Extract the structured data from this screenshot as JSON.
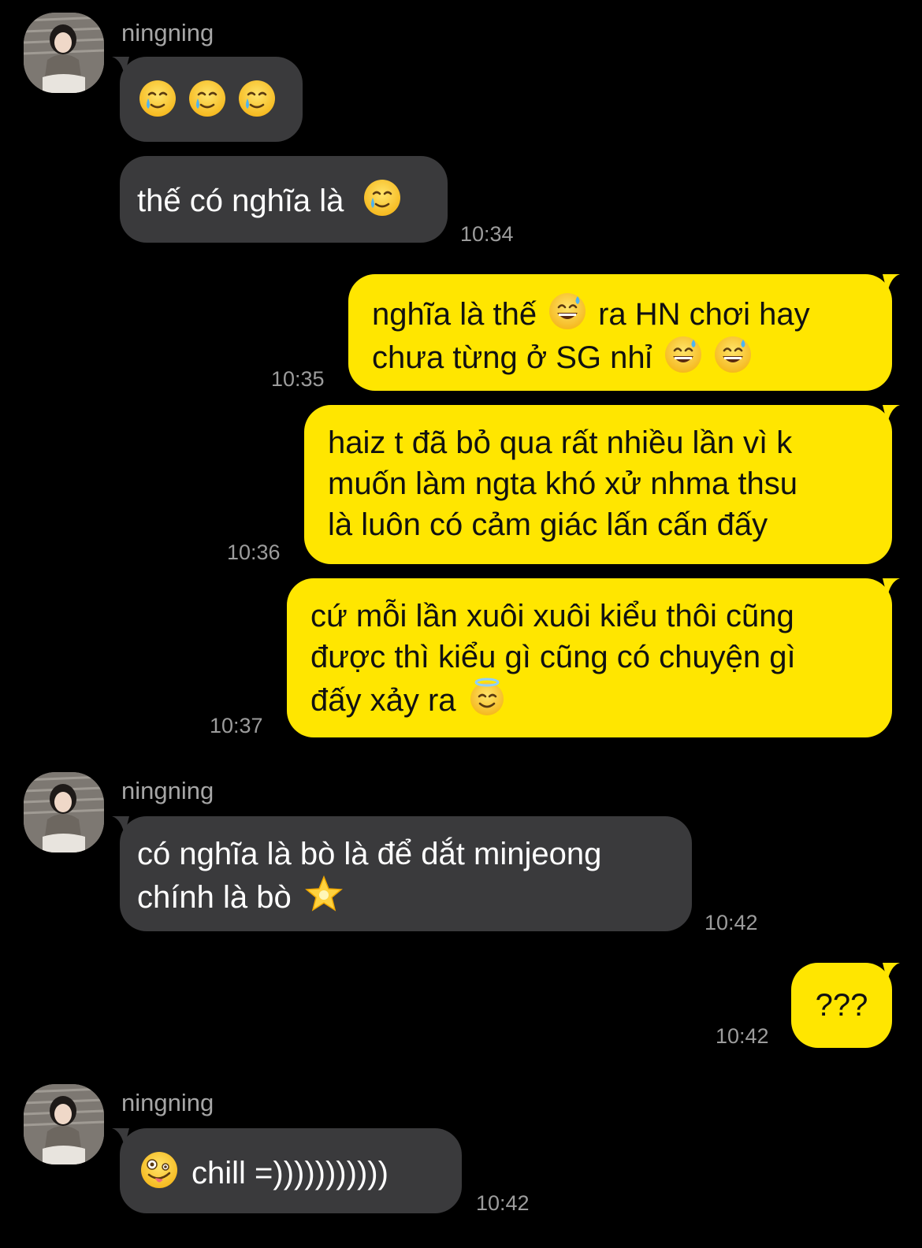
{
  "contact": {
    "name": "ningning"
  },
  "messages": [
    {
      "sender": "ningning",
      "emoji_only": [
        "crying-smile-emoji",
        "crying-smile-emoji",
        "crying-smile-emoji"
      ]
    },
    {
      "sender": "ningning",
      "text": "thế có nghĩa là",
      "emoji": "crying-smile-emoji",
      "time": "10:34"
    },
    {
      "sender": "me",
      "lines": [
        "nghĩa là thế",
        "ra HN chơi hay",
        "chưa từng ở SG nhỉ"
      ],
      "time": "10:35"
    },
    {
      "sender": "me",
      "lines": [
        "haiz t đã bỏ qua rất nhiều lần vì k",
        "muốn làm ngta khó xử nhma thsu",
        "là luôn có cảm giác lấn cấn đấy"
      ],
      "time": "10:36"
    },
    {
      "sender": "me",
      "lines": [
        "cứ mỗi lần xuôi xuôi kiểu thôi cũng",
        "được thì kiểu gì cũng có chuyện gì",
        "đấy xảy ra"
      ],
      "time": "10:37"
    },
    {
      "sender": "ningning",
      "lines": [
        "có nghĩa là bò là để dắt minjeong",
        "chính là bò"
      ],
      "time": "10:42"
    },
    {
      "sender": "me",
      "text": "???",
      "time": "10:42"
    },
    {
      "sender": "ningning",
      "text": "chill =)))))))))))",
      "time": "10:42"
    }
  ],
  "colors": {
    "incoming_bubble": "#3a3a3c",
    "outgoing_bubble": "#ffe600",
    "background": "#000000"
  }
}
